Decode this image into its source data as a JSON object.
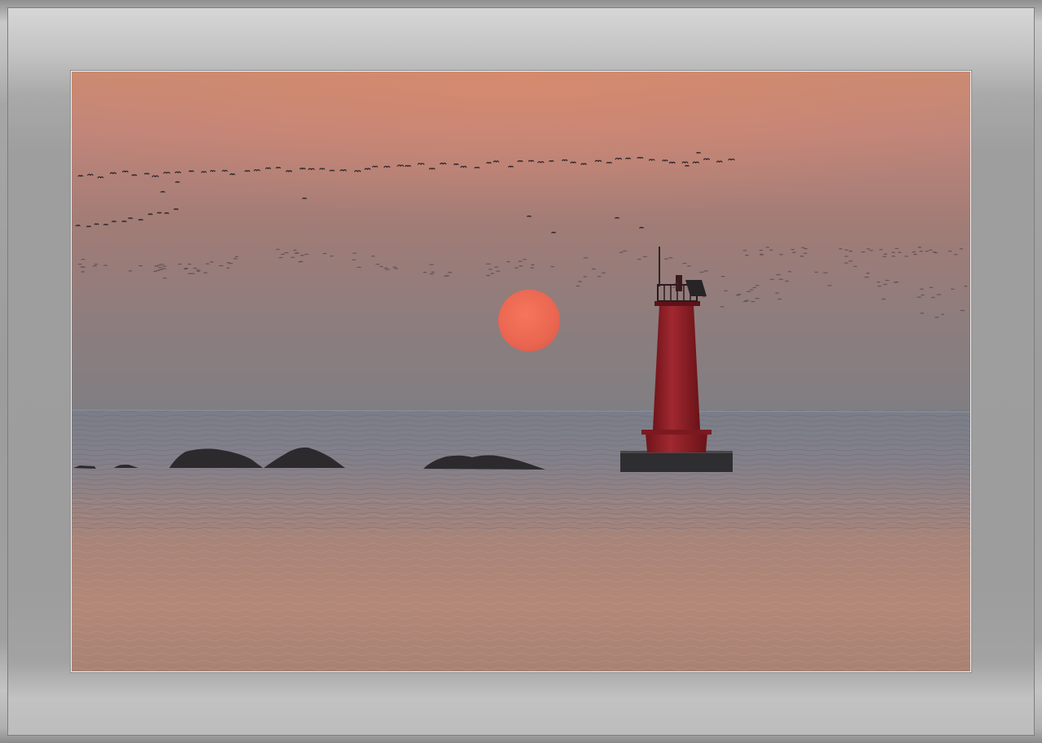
{
  "frame": {
    "outer_color": "#9a9a9a",
    "mat_color": "#a3a3a3",
    "inner_border_color": "#f2f2f2"
  },
  "photo": {
    "sky_top_color": "#c98a72",
    "sky_mid_color": "#a17c76",
    "sky_horizon_color": "#807e82",
    "sea_color": "#7d7f86",
    "sea_reflection_color": "#b8897a",
    "sun_color": "#ef6c55",
    "lighthouse_color": "#8e1f25",
    "silhouette_color": "#2a292c"
  }
}
